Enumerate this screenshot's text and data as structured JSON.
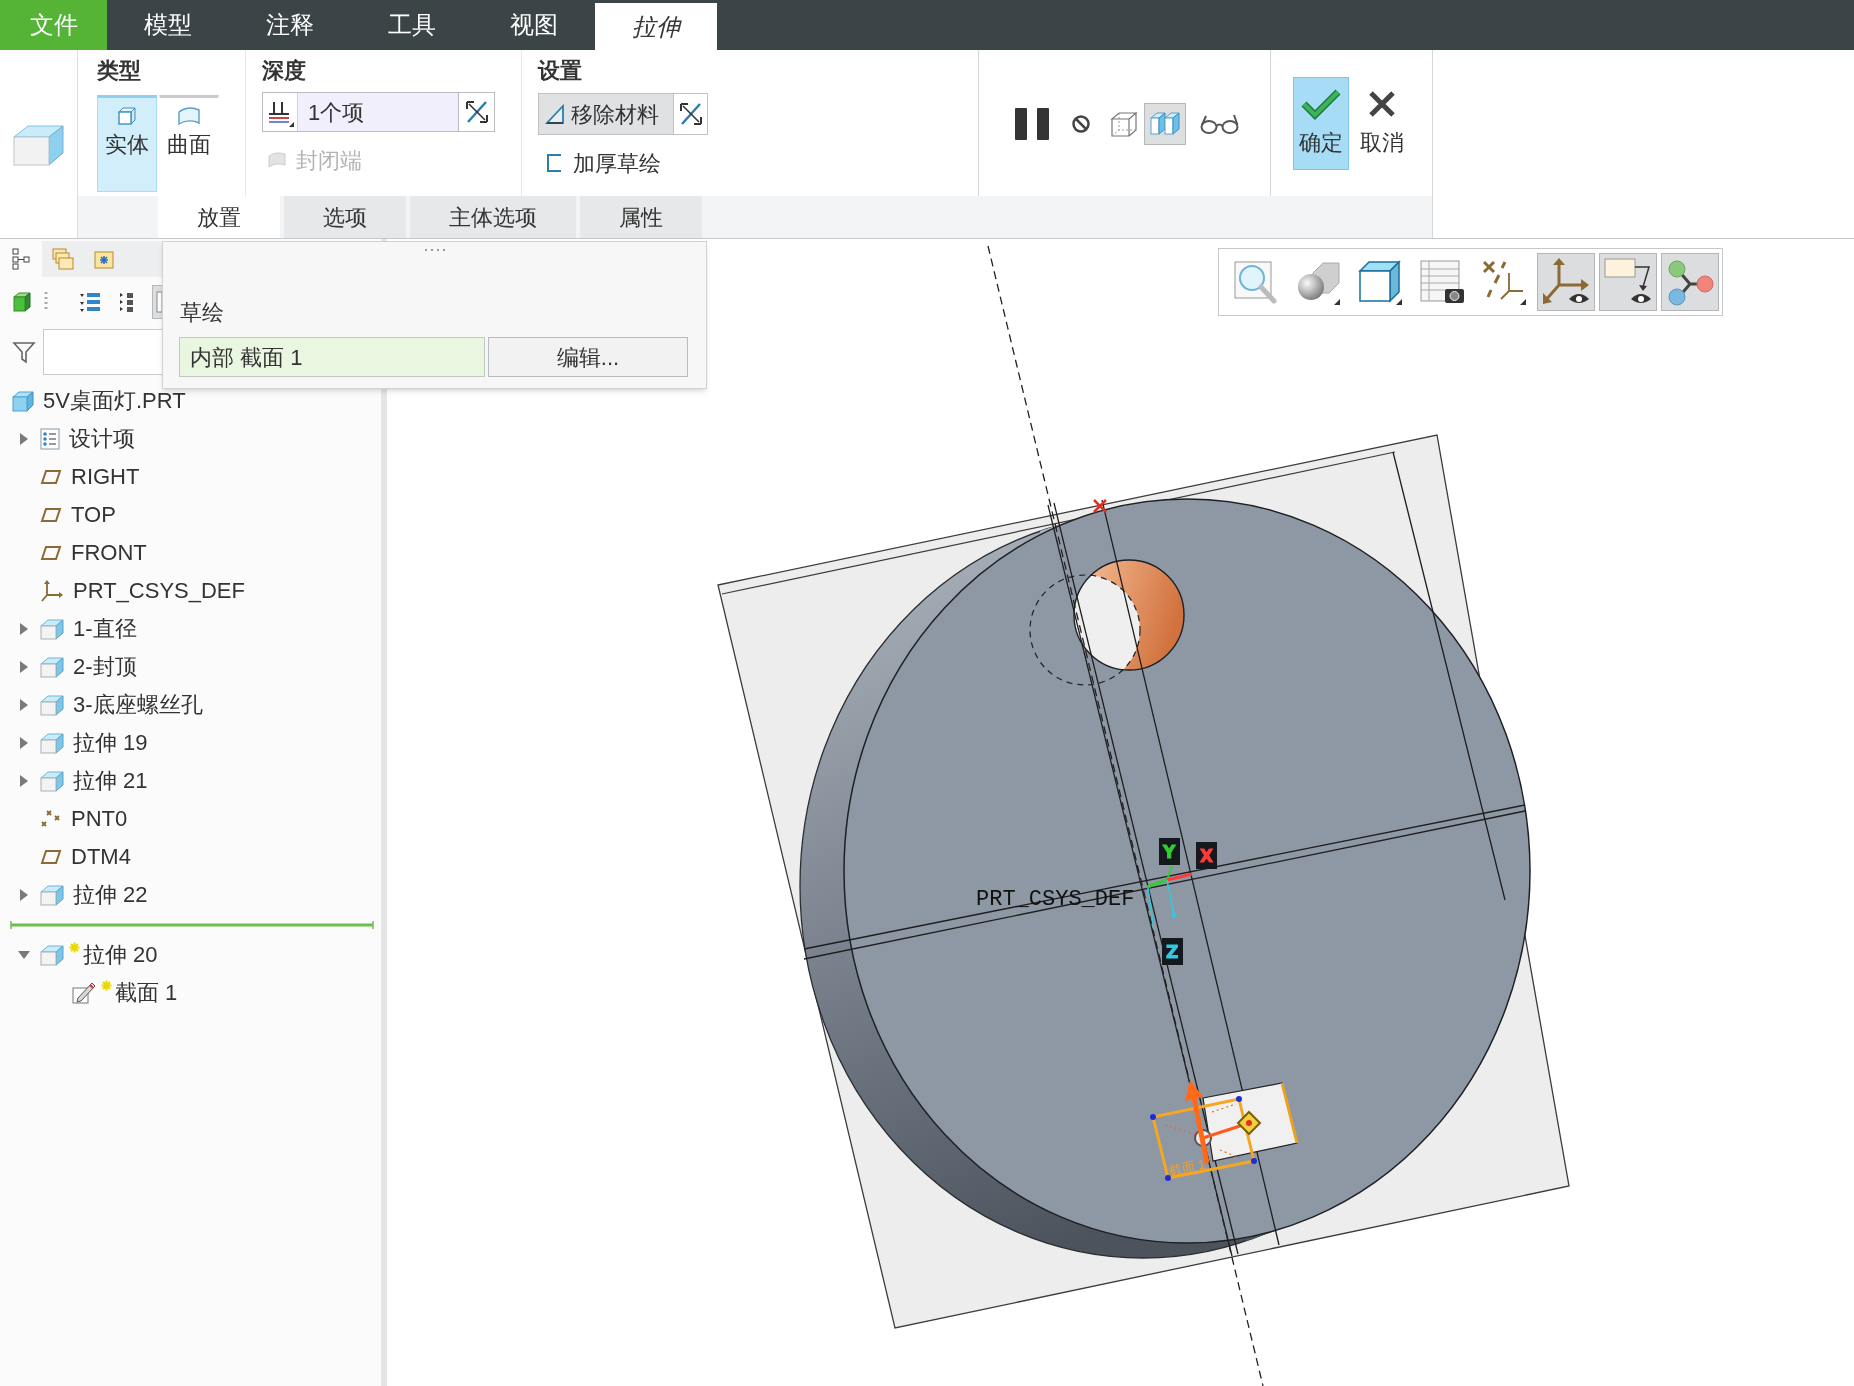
{
  "menu_tabs": [
    {
      "label": "文件",
      "kind": "file",
      "selected": false
    },
    {
      "label": "模型",
      "kind": "tab",
      "selected": false
    },
    {
      "label": "注释",
      "kind": "tab",
      "selected": false
    },
    {
      "label": "工具",
      "kind": "tab",
      "selected": false
    },
    {
      "label": "视图",
      "kind": "tab",
      "selected": false
    },
    {
      "label": "拉伸",
      "kind": "tab",
      "selected": true
    }
  ],
  "ribbon": {
    "type_group": {
      "title": "类型",
      "options": [
        {
          "label": "实体",
          "kind": "solid",
          "selected": true
        },
        {
          "label": "曲面",
          "kind": "surface",
          "selected": false
        }
      ]
    },
    "depth_group": {
      "title": "深度",
      "value": "1个项",
      "closed_end": {
        "label": "封闭端",
        "disabled": true
      }
    },
    "settings_group": {
      "title": "设置",
      "remove_material": {
        "label": "移除材料",
        "on": true
      },
      "thicken_sketch": {
        "label": "加厚草绘",
        "on": false
      }
    },
    "preview_tools": [
      {
        "kind": "pause",
        "on": false
      },
      {
        "kind": "no-preview",
        "on": false
      },
      {
        "kind": "geometry-preview",
        "on": false
      },
      {
        "kind": "verify",
        "on": true
      },
      {
        "kind": "glasses",
        "on": false
      }
    ],
    "actions": [
      {
        "label": "确定",
        "kind": "ok",
        "selected": true
      },
      {
        "label": "取消",
        "kind": "cancel",
        "selected": false
      }
    ]
  },
  "sub_tabs": [
    {
      "label": "放置",
      "selected": true
    },
    {
      "label": "选项",
      "selected": false
    },
    {
      "label": "主体选项",
      "selected": false
    },
    {
      "label": "属性",
      "selected": false
    }
  ],
  "placement_panel": {
    "label": "草绘",
    "sketch": "内部 截面 1",
    "edit_button": "编辑..."
  },
  "model_tree": {
    "toolbar": [
      {
        "kind": "display",
        "on": false
      },
      {
        "kind": "expand-all",
        "on": false
      },
      {
        "kind": "collapse-all",
        "on": false
      },
      {
        "kind": "columns",
        "on": true
      }
    ],
    "root": {
      "label": "5V桌面灯.PRT",
      "kind": "part",
      "new": false,
      "children": [
        {
          "label": "设计项",
          "kind": "design-items",
          "expanded": false,
          "new": false
        },
        {
          "label": "RIGHT",
          "kind": "plane",
          "new": false
        },
        {
          "label": "TOP",
          "kind": "plane",
          "new": false
        },
        {
          "label": "FRONT",
          "kind": "plane",
          "new": false
        },
        {
          "label": "PRT_CSYS_DEF",
          "kind": "csys",
          "new": false
        },
        {
          "label": "1-直径",
          "kind": "extrude",
          "expanded": false,
          "new": false
        },
        {
          "label": "2-封顶",
          "kind": "extrude",
          "expanded": false,
          "new": false
        },
        {
          "label": "3-底座螺丝孔",
          "kind": "extrude",
          "expanded": false,
          "new": false
        },
        {
          "label": "拉伸 19",
          "kind": "extrude",
          "expanded": false,
          "new": false
        },
        {
          "label": "拉伸 21",
          "kind": "extrude",
          "expanded": false,
          "new": false
        },
        {
          "label": "PNT0",
          "kind": "point",
          "new": false
        },
        {
          "label": "DTM4",
          "kind": "plane",
          "new": false
        },
        {
          "label": "拉伸 22",
          "kind": "extrude",
          "expanded": false,
          "new": false
        },
        {
          "kind": "insert-locator"
        },
        {
          "label": "拉伸 20",
          "kind": "extrude",
          "expanded": true,
          "new": true,
          "children": [
            {
              "label": "截面 1",
              "kind": "sketch",
              "new": true
            }
          ]
        }
      ]
    }
  },
  "view_toolbar": [
    {
      "kind": "zoom",
      "on": false
    },
    {
      "kind": "display-style",
      "on": false
    },
    {
      "kind": "saved-views",
      "on": false
    },
    {
      "kind": "view-manager",
      "on": false
    },
    {
      "kind": "datum-display",
      "on": false
    },
    {
      "kind": "csys-display",
      "on": true
    },
    {
      "kind": "annotation-display",
      "on": true
    },
    {
      "kind": "spin-center",
      "on": true
    }
  ],
  "viewport": {
    "csys_label": "PRT_CSYS_DEF",
    "axis_labels": [
      {
        "label": "Y",
        "color": "#33cc33"
      },
      {
        "label": "X",
        "color": "#ff3b3b"
      },
      {
        "label": "Z",
        "color": "#33c8e0"
      }
    ],
    "sketch_label": "截面 1"
  }
}
